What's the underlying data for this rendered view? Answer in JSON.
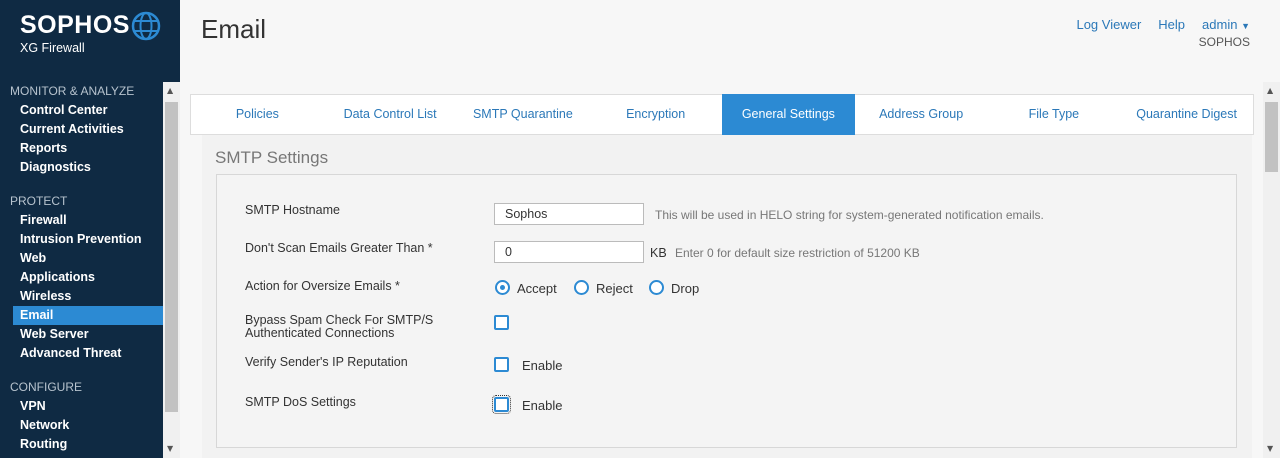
{
  "brand": {
    "name": "SOPHOS",
    "product": "XG Firewall"
  },
  "nav": {
    "sections": [
      {
        "title": "MONITOR & ANALYZE",
        "items": [
          "Control Center",
          "Current Activities",
          "Reports",
          "Diagnostics"
        ]
      },
      {
        "title": "PROTECT",
        "items": [
          "Firewall",
          "Intrusion Prevention",
          "Web",
          "Applications",
          "Wireless",
          "Email",
          "Web Server",
          "Advanced Threat"
        ]
      },
      {
        "title": "CONFIGURE",
        "items": [
          "VPN",
          "Network",
          "Routing"
        ]
      }
    ],
    "active": "Email"
  },
  "header": {
    "title": "Email",
    "links": {
      "log_viewer": "Log Viewer",
      "help": "Help",
      "admin": "admin"
    },
    "org": "SOPHOS"
  },
  "tabs": [
    "Policies",
    "Data Control List",
    "SMTP Quarantine",
    "Encryption",
    "General Settings",
    "Address Group",
    "File Type",
    "Quarantine Digest"
  ],
  "active_tab": "General Settings",
  "smtp": {
    "section_title": "SMTP Settings",
    "hostname": {
      "label": "SMTP Hostname",
      "value": "Sophos",
      "hint": "This will be used in HELO string for system-generated notification emails."
    },
    "max_size": {
      "label": "Don't Scan Emails Greater Than *",
      "value": "0",
      "unit": "KB",
      "hint": "Enter 0 for default size restriction of 51200 KB"
    },
    "oversize": {
      "label": "Action for Oversize Emails *",
      "options": [
        "Accept",
        "Reject",
        "Drop"
      ],
      "selected": "Accept"
    },
    "bypass": {
      "label_line1": "Bypass Spam Check For SMTP/S",
      "label_line2": "Authenticated Connections",
      "checked": false
    },
    "ip_reputation": {
      "label": "Verify Sender's IP Reputation",
      "option": "Enable",
      "checked": false
    },
    "dos": {
      "label": "SMTP DoS Settings",
      "option": "Enable",
      "checked": false
    }
  },
  "colors": {
    "sidebar": "#0f2a43",
    "accent": "#2c8ad3",
    "link": "#2b78b8"
  }
}
